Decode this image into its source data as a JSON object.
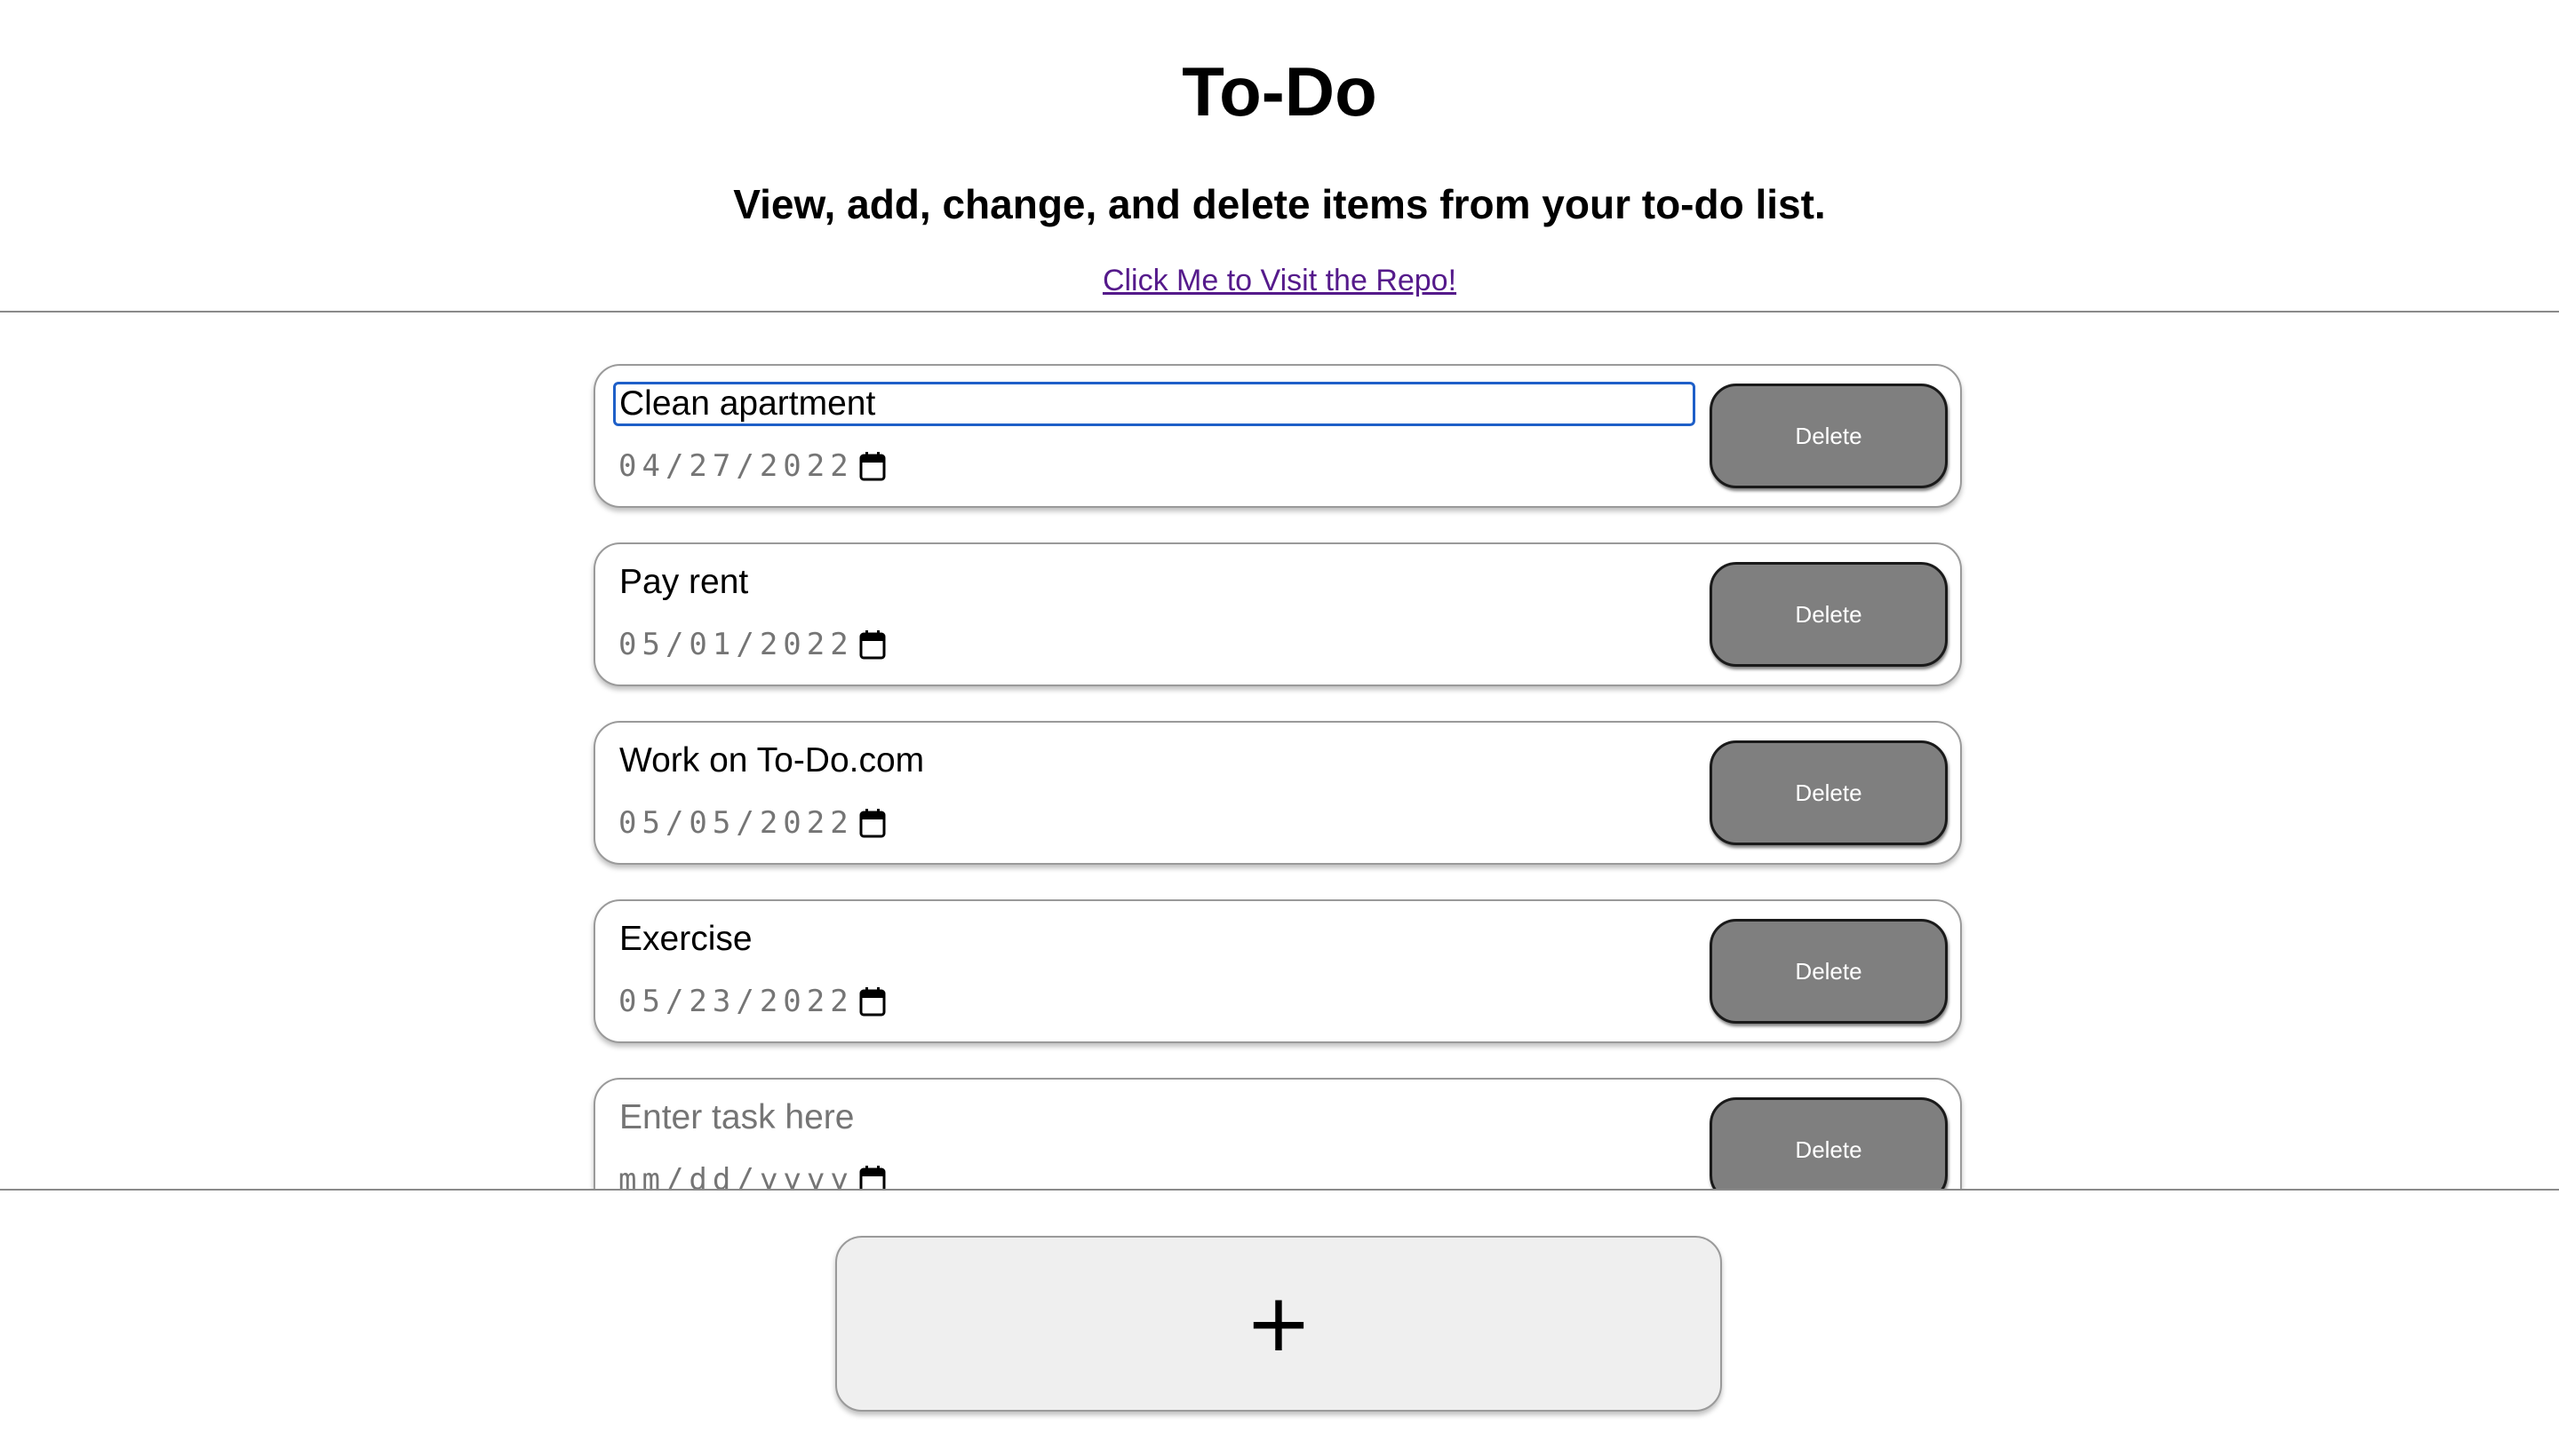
{
  "header": {
    "title": "To-Do",
    "subtitle": "View, add, change, and delete items from your to-do list.",
    "repo_link": "Click Me to Visit the Repo!"
  },
  "tasks": [
    {
      "text": "Clean apartment",
      "placeholder": "Enter task here",
      "date": "04/27/2022",
      "delete_label": "Delete",
      "focused": true
    },
    {
      "text": "Pay rent",
      "placeholder": "Enter task here",
      "date": "05/01/2022",
      "delete_label": "Delete"
    },
    {
      "text": "Work on To-Do.com",
      "placeholder": "Enter task here",
      "date": "05/05/2022",
      "delete_label": "Delete"
    },
    {
      "text": "Exercise",
      "placeholder": "Enter task here",
      "date": "05/23/2022",
      "delete_label": "Delete"
    },
    {
      "text": "",
      "placeholder": "Enter task here",
      "date": "mm/dd/yyyy",
      "delete_label": "Delete"
    }
  ],
  "footer": {
    "add_label": "+"
  },
  "icons": {
    "date_picker": "calendar-icon"
  },
  "colors": {
    "focus_ring": "#1e5fc8",
    "delete_button_bg": "#7f7f7f",
    "add_button_bg": "#efefef",
    "link_visited": "#551a8b"
  }
}
